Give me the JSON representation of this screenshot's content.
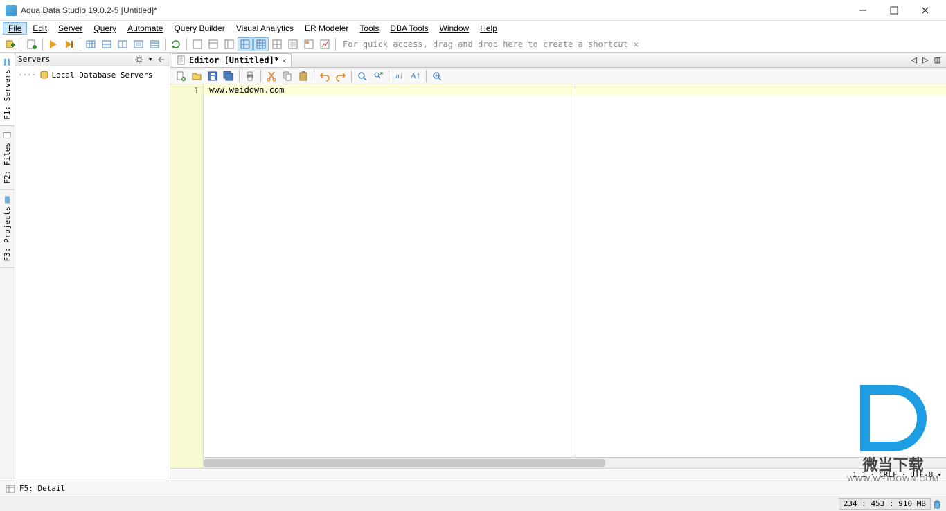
{
  "window": {
    "title": "Aqua Data Studio 19.0.2-5 [Untitled]*"
  },
  "menu": {
    "items": [
      "File",
      "Edit",
      "Server",
      "Query",
      "Automate",
      "Query Builder",
      "Visual Analytics",
      "ER Modeler",
      "Tools",
      "DBA Tools",
      "Window",
      "Help"
    ],
    "active_index": 0
  },
  "main_toolbar": {
    "placeholder_text": "For quick access, drag and drop here to create a shortcut",
    "icons": [
      "register-server-icon",
      "sep",
      "new-query-icon",
      "sep",
      "run-icon",
      "run-selection-icon",
      "sep",
      "grid-icon",
      "grid2-icon",
      "grid3-icon",
      "grid4-icon",
      "grid5-icon",
      "sep",
      "refresh-icon",
      "sep",
      "layout1-icon",
      "layout2-icon",
      "layout3-icon",
      "layout4-icon",
      "layout5-icon",
      "layout6-icon",
      "layout7-icon",
      "layout8-icon",
      "layout9-icon"
    ]
  },
  "left_tabs": [
    {
      "label": "F1: Servers",
      "active": true,
      "icon": "server-icon"
    },
    {
      "label": "F2: Files",
      "active": false,
      "icon": "file-icon"
    },
    {
      "label": "F3: Projects",
      "active": false,
      "icon": "project-icon"
    }
  ],
  "servers_panel": {
    "title": "Servers",
    "tree": [
      {
        "label": "Local Database Servers",
        "icon": "db-group-icon"
      }
    ]
  },
  "editor": {
    "tab_label": "Editor [Untitled]*",
    "line_numbers": [
      "1"
    ],
    "content_line1": "www.weidown.com",
    "status": {
      "cursor": "1:1",
      "line_ending": "CRLF",
      "encoding": "UTF-8"
    },
    "toolbar_icons": [
      "new-file-icon",
      "open-icon",
      "save-icon",
      "save-all-icon",
      "sep",
      "print-icon",
      "sep",
      "cut-icon",
      "copy-icon",
      "paste-icon",
      "sep",
      "undo-icon",
      "redo-icon",
      "sep",
      "find-icon",
      "replace-icon",
      "sep",
      "lowercase-icon",
      "uppercase-icon",
      "sep",
      "zoom-icon"
    ]
  },
  "detail_bar": {
    "label": "F5: Detail"
  },
  "status_bar": {
    "usage": "234 : 453 : 910 MB"
  },
  "watermark": {
    "text_cn": "微当下载",
    "url": "WWW.WEIDOWN.COM"
  }
}
